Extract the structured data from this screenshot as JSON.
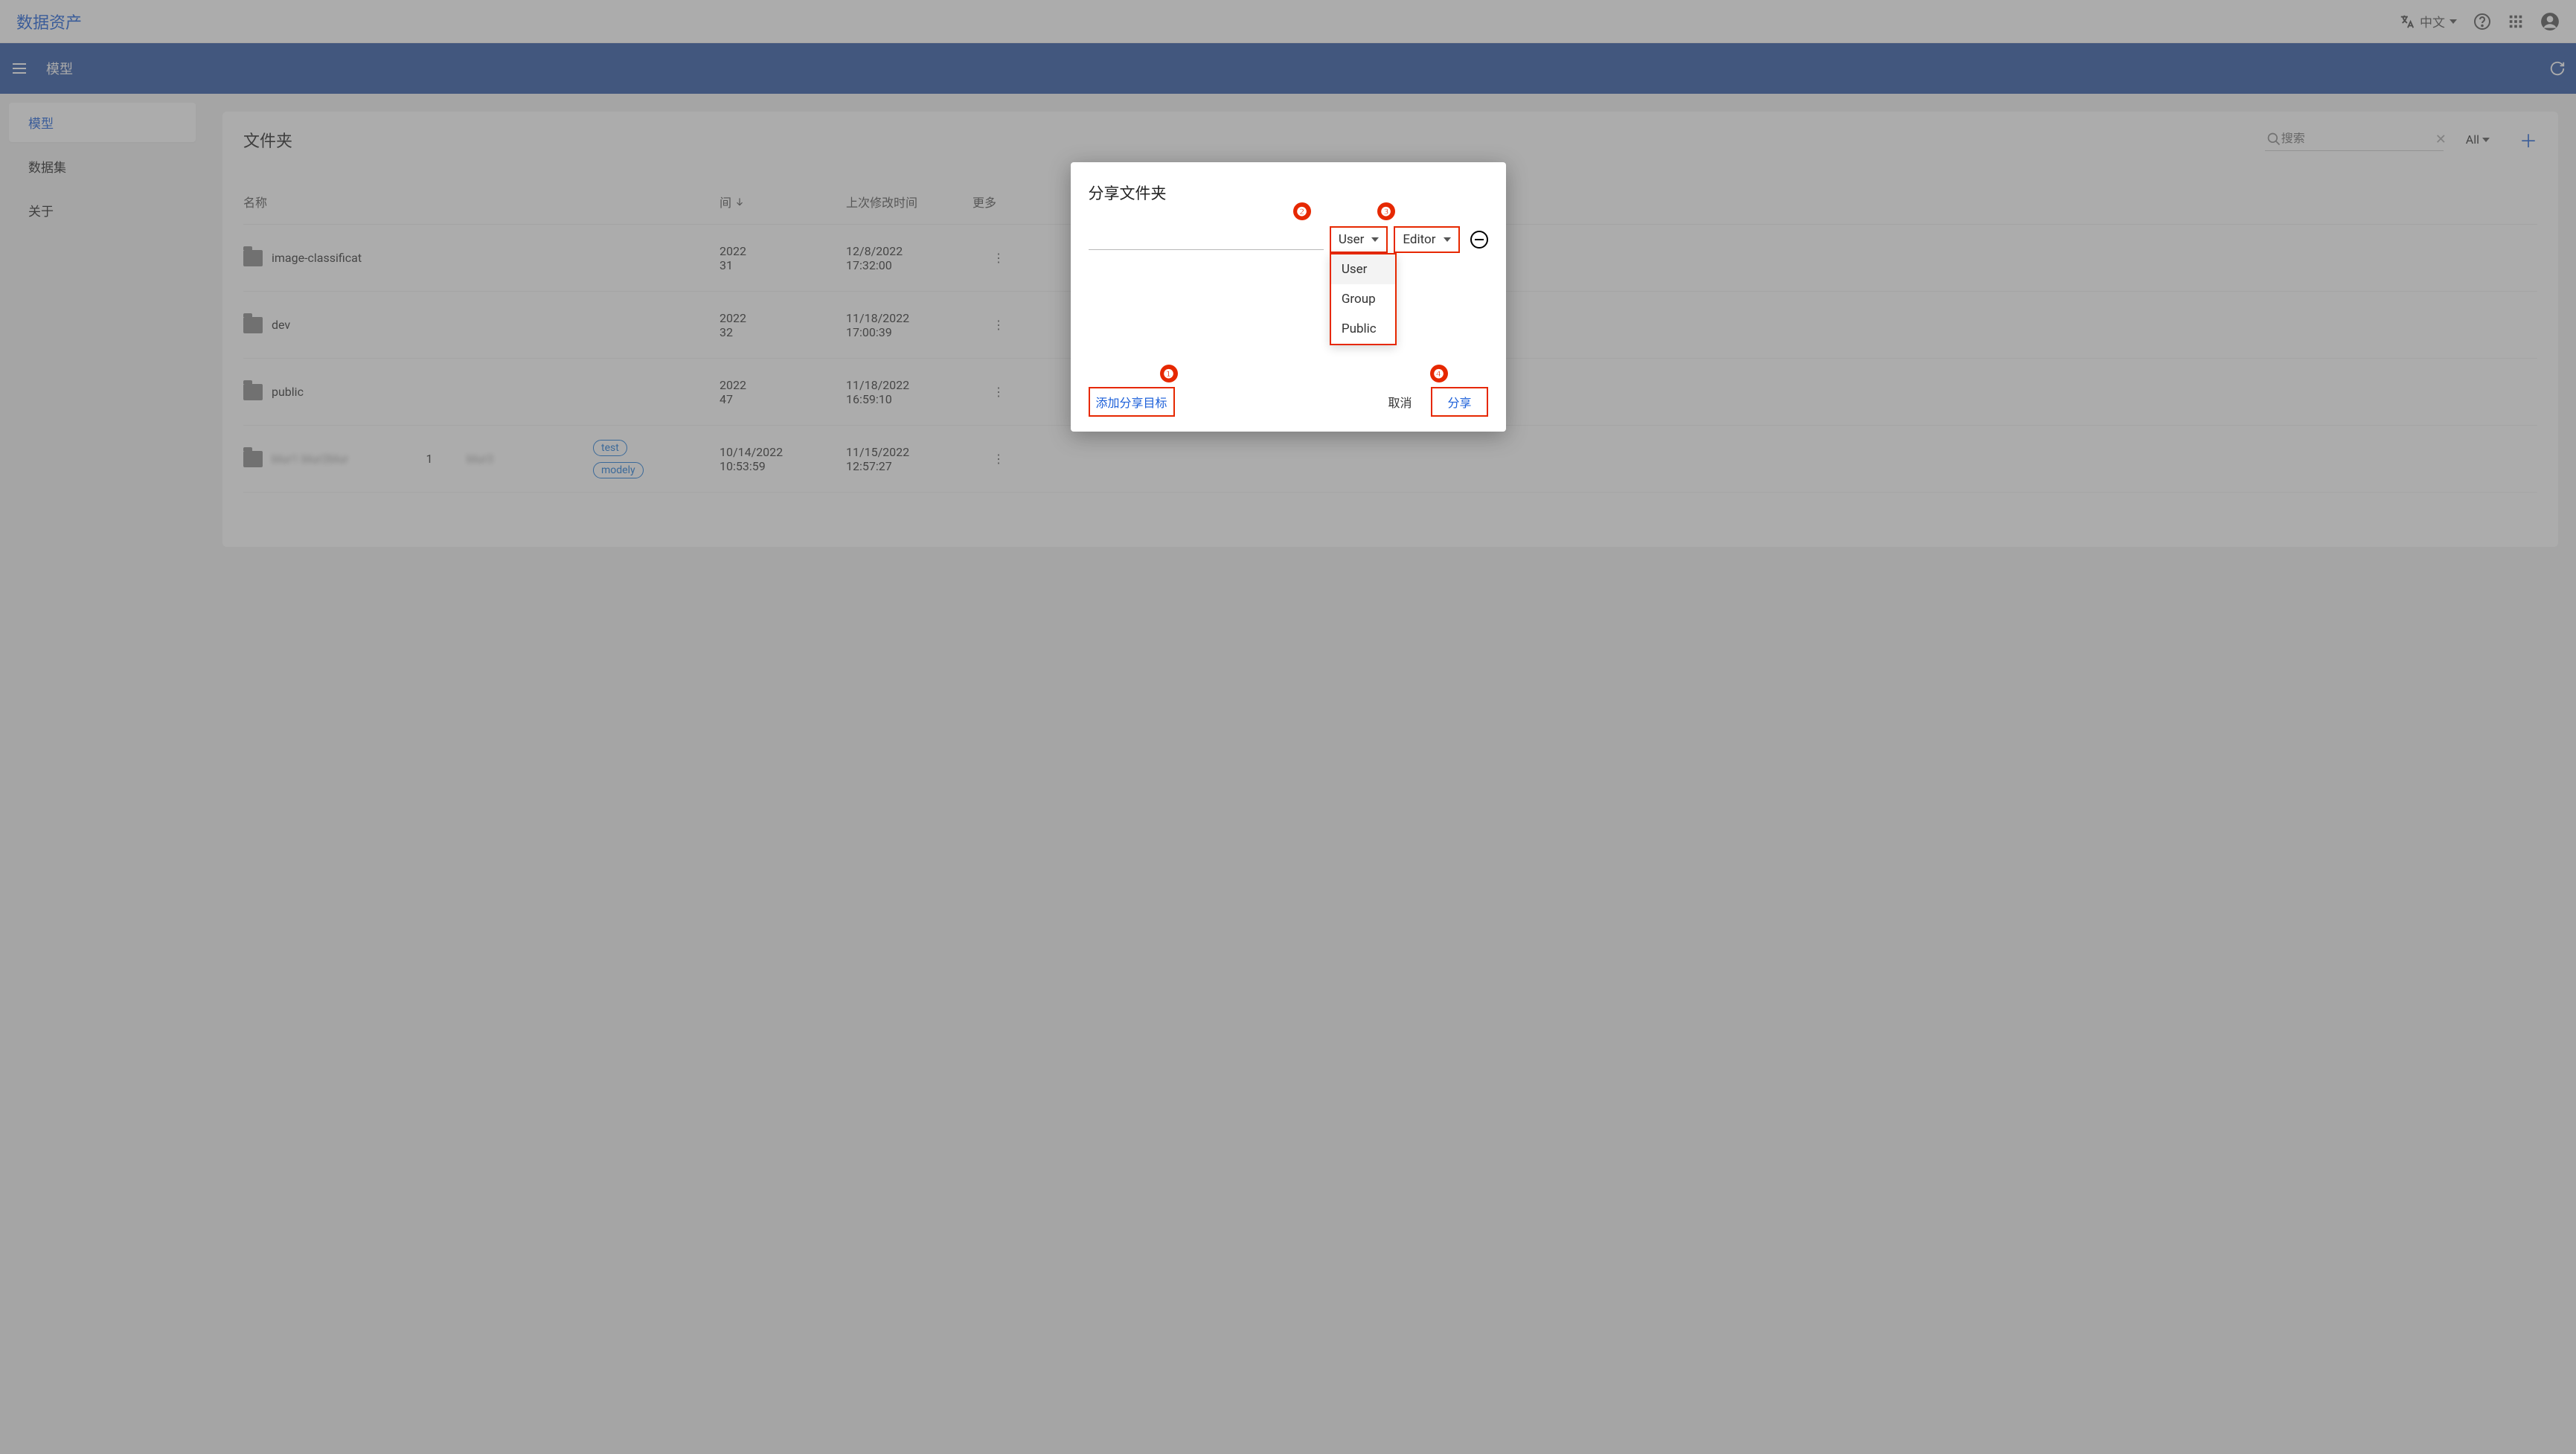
{
  "header": {
    "app_title": "数据资产",
    "language_label": "中文"
  },
  "bluebar": {
    "title": "模型"
  },
  "sidebar": {
    "items": [
      {
        "label": "模型",
        "active": true
      },
      {
        "label": "数据集",
        "active": false
      },
      {
        "label": "关于",
        "active": false
      }
    ]
  },
  "content": {
    "title": "文件夹",
    "search_placeholder": "搜索",
    "filter_label": "All",
    "columns": {
      "name": "名称",
      "count": "",
      "owner": "",
      "tags": "",
      "time_partial": "间",
      "modified": "上次修改时间",
      "more": "更多"
    },
    "rows": [
      {
        "name": "image-classificat",
        "count": "",
        "owner": "",
        "tags": [],
        "t1a": "2022",
        "t1b": "31",
        "t2a": "12/8/2022",
        "t2b": "17:32:00"
      },
      {
        "name": "dev",
        "count": "",
        "owner": "",
        "tags": [],
        "t1a": "2022",
        "t1b": "32",
        "t2a": "11/18/2022",
        "t2b": "17:00:39"
      },
      {
        "name": "public",
        "count": "",
        "owner": "",
        "tags": [],
        "t1a": "2022",
        "t1b": "47",
        "t2a": "11/18/2022",
        "t2b": "16:59:10"
      },
      {
        "name": "blur1 blur2blur",
        "count": "1",
        "owner": "blur3",
        "tags": [
          "test",
          "modely"
        ],
        "t1a": "10/14/2022",
        "t1b": "10:53:59",
        "t2a": "11/15/2022",
        "t2b": "12:57:27"
      }
    ]
  },
  "dialog": {
    "title": "分享文件夹",
    "type_select_value": "User",
    "role_select_value": "Editor",
    "dropdown_options": [
      "User",
      "Group",
      "Public"
    ],
    "add_target_label": "添加分享目标",
    "cancel_label": "取消",
    "share_label": "分享",
    "annotations": {
      "n1": "❶",
      "n2": "❷",
      "n3": "❸",
      "n4": "❹"
    }
  }
}
